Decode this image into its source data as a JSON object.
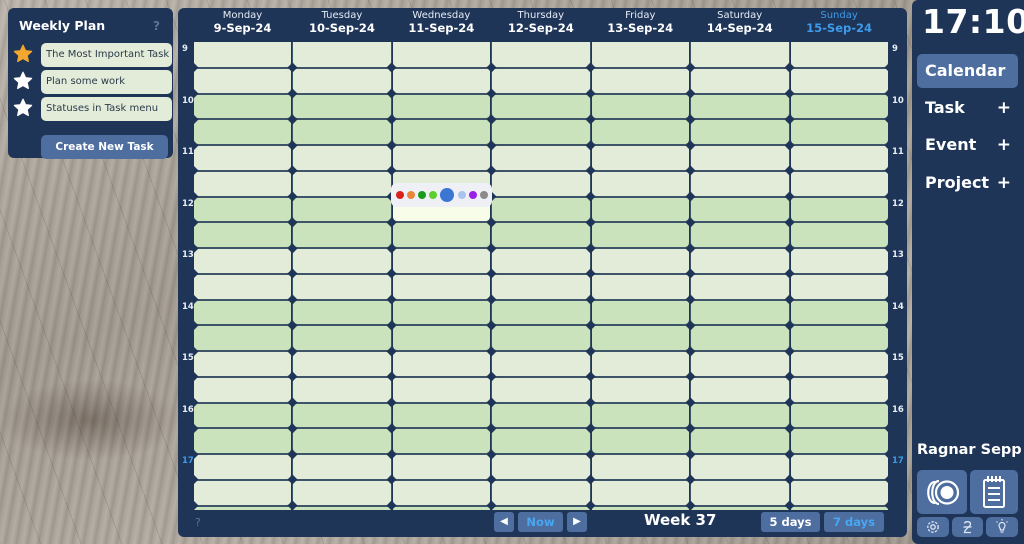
{
  "weekly_plan": {
    "title": "Weekly Plan",
    "help": "?",
    "tasks": [
      {
        "label": "The Most Important Task",
        "star": "star-filled-icon",
        "star_color": "#f4a72e"
      },
      {
        "label": "Plan some work",
        "star": "star-icon",
        "star_color": "#ffffff"
      },
      {
        "label": "Statuses in Task menu",
        "star": "star-icon",
        "star_color": "#ffffff"
      }
    ],
    "create_button": "Create New Task"
  },
  "calendar": {
    "days": [
      {
        "name": "Monday",
        "date": "9-Sep-24",
        "today": false
      },
      {
        "name": "Tuesday",
        "date": "10-Sep-24",
        "today": false
      },
      {
        "name": "Wednesday",
        "date": "11-Sep-24",
        "today": false
      },
      {
        "name": "Thursday",
        "date": "12-Sep-24",
        "today": false
      },
      {
        "name": "Friday",
        "date": "13-Sep-24",
        "today": false
      },
      {
        "name": "Saturday",
        "date": "14-Sep-24",
        "today": false
      },
      {
        "name": "Sunday",
        "date": "15-Sep-24",
        "today": true
      }
    ],
    "hours": [
      "9",
      "10",
      "11",
      "12",
      "13",
      "14",
      "15",
      "16",
      "17"
    ],
    "current_hour": "17",
    "selected_slot": {
      "day": "Wednesday",
      "time": "12:00"
    },
    "color_palette": {
      "colors": [
        "#d8201c",
        "#e8873a",
        "#189a1c",
        "#5ccf2d",
        "#3b76d3",
        "#a9c4ec",
        "#9b1ee8",
        "#8a8a8a"
      ],
      "selected_index": 4
    },
    "colors": {
      "light_row": "#e2ecd8",
      "dark_row": "#cbe3bd",
      "selected_cell": "#f7fde9",
      "today_accent": "#3d9be9"
    },
    "footer": {
      "help": "?",
      "prev_icon": "◀",
      "now_label": "Now",
      "next_icon": "▶",
      "week_label": "Week 37",
      "view_5_days": "5 days",
      "view_7_days": "7 days",
      "active_view": "7 days"
    }
  },
  "sidebar": {
    "clock": "17:10",
    "menu": [
      {
        "label": "Calendar",
        "active": true,
        "plus": ""
      },
      {
        "label": "Task",
        "active": false,
        "plus": "+"
      },
      {
        "label": "Event",
        "active": false,
        "plus": "+"
      },
      {
        "label": "Project",
        "active": false,
        "plus": "+"
      }
    ],
    "user_name": "Ragnar Sepp",
    "buttons": {
      "big": [
        "coins-icon",
        "notepad-icon"
      ],
      "small": [
        "settings-icon",
        "currency-icon",
        "lightbulb-icon"
      ]
    }
  }
}
